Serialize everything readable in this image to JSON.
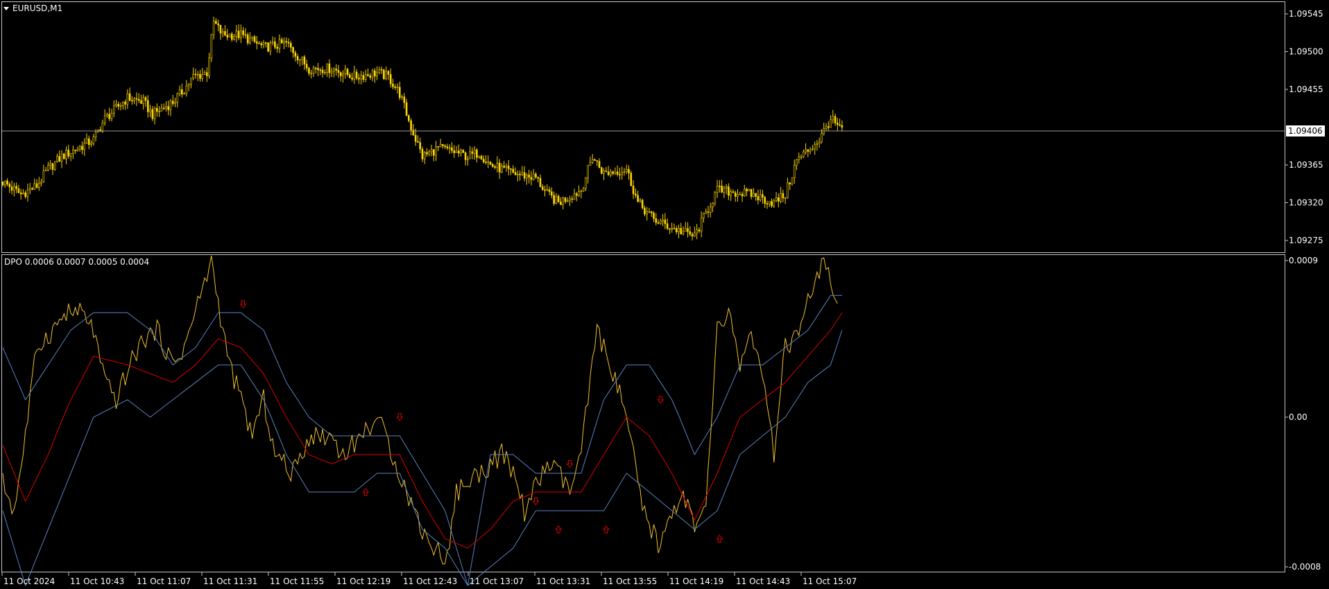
{
  "symbol_label": "EURUSD,M1",
  "indicator_label": "DPO 0.0006 0.0007 0.0005 0.0004",
  "colors": {
    "background": "#000000",
    "frame": "#c8c8c8",
    "candle": "#ffd700",
    "dpo": "#f2c12e",
    "band": "#5b84c4",
    "middle": "#e00000",
    "arrow": "#e00000",
    "price_line": "#9a9a9a"
  },
  "current_price": "1.09406",
  "chart_data": [
    {
      "type": "candlestick",
      "title": "EURUSD,M1",
      "ylim": [
        1.0926,
        1.0956
      ],
      "y_ticks": [
        "1.09545",
        "1.09500",
        "1.09455",
        "1.09365",
        "1.09320",
        "1.09275"
      ],
      "x_ticks": [
        "11 Oct 2024",
        "11 Oct 10:43",
        "11 Oct 11:07",
        "11 Oct 11:31",
        "11 Oct 11:55",
        "11 Oct 12:19",
        "11 Oct 12:43",
        "11 Oct 13:07",
        "11 Oct 13:31",
        "11 Oct 13:55",
        "11 Oct 14:19",
        "11 Oct 14:43",
        "11 Oct 15:07"
      ],
      "close_path": [
        [
          0,
          1.09345
        ],
        [
          8,
          1.0933
        ],
        [
          15,
          1.0934
        ],
        [
          20,
          1.0936
        ],
        [
          26,
          1.09375
        ],
        [
          33,
          1.09385
        ],
        [
          40,
          1.09395
        ],
        [
          45,
          1.0942
        ],
        [
          55,
          1.09445
        ],
        [
          62,
          1.0944
        ],
        [
          66,
          1.09425
        ],
        [
          75,
          1.0944
        ],
        [
          80,
          1.09455
        ],
        [
          84,
          1.0947
        ],
        [
          90,
          1.09475
        ],
        [
          93,
          1.09535
        ],
        [
          97,
          1.0952
        ],
        [
          105,
          1.0952
        ],
        [
          115,
          1.09505
        ],
        [
          125,
          1.0951
        ],
        [
          135,
          1.0948
        ],
        [
          145,
          1.0948
        ],
        [
          155,
          1.0947
        ],
        [
          165,
          1.09475
        ],
        [
          170,
          1.0947
        ],
        [
          175,
          1.0945
        ],
        [
          180,
          1.0941
        ],
        [
          185,
          1.09375
        ],
        [
          192,
          1.09385
        ],
        [
          200,
          1.0938
        ],
        [
          205,
          1.09375
        ],
        [
          210,
          1.0938
        ],
        [
          215,
          1.09365
        ],
        [
          225,
          1.09355
        ],
        [
          235,
          1.0935
        ],
        [
          240,
          1.0933
        ],
        [
          245,
          1.0932
        ],
        [
          255,
          1.09335
        ],
        [
          260,
          1.09375
        ],
        [
          265,
          1.09355
        ],
        [
          275,
          1.0936
        ],
        [
          280,
          1.0932
        ],
        [
          287,
          1.093
        ],
        [
          295,
          1.0929
        ],
        [
          305,
          1.0928
        ],
        [
          315,
          1.09335
        ],
        [
          330,
          1.0933
        ],
        [
          340,
          1.0932
        ],
        [
          345,
          1.0933
        ],
        [
          350,
          1.0937
        ],
        [
          360,
          1.09395
        ],
        [
          365,
          1.0942
        ],
        [
          370,
          1.09405
        ]
      ]
    },
    {
      "type": "line",
      "title": "DPO 0.0006 0.0007 0.0005 0.0004",
      "ylim": [
        -0.0008,
        0.0009
      ],
      "y_ticks": [
        "0.0009",
        "0.00",
        "-0.0008"
      ],
      "series": [
        {
          "name": "DPO",
          "points": [
            [
              0,
              -0.00035
            ],
            [
              5,
              -0.0005
            ],
            [
              10,
              -0.0001
            ],
            [
              15,
              0.0004
            ],
            [
              22,
              0.0005
            ],
            [
              28,
              0.0006
            ],
            [
              35,
              0.0006
            ],
            [
              40,
              0.0005
            ],
            [
              45,
              0.0002
            ],
            [
              50,
              0.0001
            ],
            [
              56,
              0.0003
            ],
            [
              62,
              0.00045
            ],
            [
              68,
              0.0005
            ],
            [
              75,
              0.0003
            ],
            [
              80,
              0.0004
            ],
            [
              86,
              0.00065
            ],
            [
              92,
              0.0009
            ],
            [
              97,
              0.0005
            ],
            [
              100,
              0.0003
            ],
            [
              105,
              0.0001
            ],
            [
              110,
              -0.0001
            ],
            [
              115,
              0.0001
            ],
            [
              120,
              -0.0002
            ],
            [
              128,
              -0.0003
            ],
            [
              135,
              -0.0001
            ],
            [
              145,
              -0.0001
            ],
            [
              150,
              -0.0002
            ],
            [
              158,
              -0.0001
            ],
            [
              165,
              0.0
            ],
            [
              172,
              -0.0002
            ],
            [
              178,
              -0.0004
            ],
            [
              185,
              -0.0006
            ],
            [
              190,
              -0.0007
            ],
            [
              196,
              -0.00075
            ],
            [
              200,
              -0.0004
            ],
            [
              210,
              -0.0003
            ],
            [
              220,
              -0.0002
            ],
            [
              225,
              -0.0003
            ],
            [
              230,
              -0.0005
            ],
            [
              240,
              -0.00025
            ],
            [
              245,
              -0.0003
            ],
            [
              250,
              -0.0004
            ],
            [
              255,
              -0.0002
            ],
            [
              262,
              0.0005
            ],
            [
              268,
              0.0003
            ],
            [
              275,
              0.0
            ],
            [
              282,
              -0.0005
            ],
            [
              290,
              -0.0007
            ],
            [
              295,
              -0.0005
            ],
            [
              300,
              -0.0004
            ],
            [
              305,
              -0.0006
            ],
            [
              310,
              -0.0005
            ],
            [
              315,
              0.0005
            ],
            [
              320,
              0.0006
            ],
            [
              325,
              0.0003
            ],
            [
              330,
              0.0005
            ],
            [
              335,
              0.0002
            ],
            [
              340,
              -0.0002
            ],
            [
              345,
              0.0004
            ],
            [
              352,
              0.0005
            ],
            [
              356,
              0.0007
            ],
            [
              362,
              0.0009
            ],
            [
              368,
              0.0006
            ]
          ]
        },
        {
          "name": "Upper band",
          "points": [
            [
              0,
              0.0004
            ],
            [
              10,
              0.0001
            ],
            [
              20,
              0.0003
            ],
            [
              30,
              0.0005
            ],
            [
              40,
              0.0006
            ],
            [
              55,
              0.0006
            ],
            [
              65,
              0.0005
            ],
            [
              75,
              0.0003
            ],
            [
              85,
              0.0004
            ],
            [
              95,
              0.0006
            ],
            [
              105,
              0.0006
            ],
            [
              115,
              0.0005
            ],
            [
              125,
              0.0002
            ],
            [
              135,
              0.0
            ],
            [
              145,
              -0.0001
            ],
            [
              155,
              -0.0001
            ],
            [
              165,
              -0.0001
            ],
            [
              175,
              -0.0001
            ],
            [
              185,
              -0.0003
            ],
            [
              195,
              -0.0005
            ],
            [
              205,
              -0.0009
            ],
            [
              215,
              -0.0002
            ],
            [
              225,
              -0.0002
            ],
            [
              235,
              -0.0003
            ],
            [
              245,
              -0.0003
            ],
            [
              255,
              -0.0003
            ],
            [
              265,
              0.0001
            ],
            [
              275,
              0.0003
            ],
            [
              285,
              0.0003
            ],
            [
              295,
              0.0001
            ],
            [
              305,
              -0.0002
            ],
            [
              315,
              0.0
            ],
            [
              325,
              0.0003
            ],
            [
              335,
              0.0003
            ],
            [
              345,
              0.0004
            ],
            [
              355,
              0.0005
            ],
            [
              365,
              0.0007
            ],
            [
              370,
              0.0007
            ]
          ]
        },
        {
          "name": "Lower band",
          "points": [
            [
              0,
              -0.0005
            ],
            [
              10,
              -0.0009
            ],
            [
              20,
              -0.0006
            ],
            [
              30,
              -0.0003
            ],
            [
              40,
              0.0
            ],
            [
              55,
              0.0001
            ],
            [
              65,
              0.0
            ],
            [
              75,
              0.0001
            ],
            [
              85,
              0.0002
            ],
            [
              95,
              0.0003
            ],
            [
              105,
              0.0003
            ],
            [
              115,
              0.0001
            ],
            [
              125,
              -0.0002
            ],
            [
              135,
              -0.0004
            ],
            [
              145,
              -0.0004
            ],
            [
              155,
              -0.0004
            ],
            [
              165,
              -0.0003
            ],
            [
              175,
              -0.0003
            ],
            [
              185,
              -0.0006
            ],
            [
              195,
              -0.0007
            ],
            [
              205,
              -0.0009
            ],
            [
              215,
              -0.0008
            ],
            [
              225,
              -0.0007
            ],
            [
              235,
              -0.0005
            ],
            [
              245,
              -0.0005
            ],
            [
              255,
              -0.0005
            ],
            [
              265,
              -0.0005
            ],
            [
              275,
              -0.0003
            ],
            [
              285,
              -0.0004
            ],
            [
              295,
              -0.0005
            ],
            [
              305,
              -0.0006
            ],
            [
              315,
              -0.0005
            ],
            [
              325,
              -0.0002
            ],
            [
              335,
              -0.0001
            ],
            [
              345,
              0.0
            ],
            [
              355,
              0.0002
            ],
            [
              365,
              0.0003
            ],
            [
              370,
              0.0005
            ]
          ]
        },
        {
          "name": "Middle",
          "points": [
            [
              0,
              -0.00015
            ],
            [
              10,
              -0.00045
            ],
            [
              20,
              -0.0002
            ],
            [
              30,
              0.0001
            ],
            [
              40,
              0.00035
            ],
            [
              55,
              0.0003
            ],
            [
              65,
              0.00025
            ],
            [
              75,
              0.0002
            ],
            [
              85,
              0.0003
            ],
            [
              95,
              0.00045
            ],
            [
              105,
              0.0004
            ],
            [
              115,
              0.00025
            ],
            [
              125,
              0.0
            ],
            [
              135,
              -0.0002
            ],
            [
              145,
              -0.00025
            ],
            [
              155,
              -0.0002
            ],
            [
              165,
              -0.0002
            ],
            [
              175,
              -0.0002
            ],
            [
              185,
              -0.00045
            ],
            [
              195,
              -0.00065
            ],
            [
              205,
              -0.0007
            ],
            [
              215,
              -0.0006
            ],
            [
              225,
              -0.00045
            ],
            [
              235,
              -0.0004
            ],
            [
              245,
              -0.0004
            ],
            [
              255,
              -0.0004
            ],
            [
              265,
              -0.0002
            ],
            [
              275,
              0.0
            ],
            [
              285,
              -0.0001
            ],
            [
              295,
              -0.0003
            ],
            [
              305,
              -0.00055
            ],
            [
              315,
              -0.0003
            ],
            [
              325,
              0.0
            ],
            [
              335,
              0.0001
            ],
            [
              345,
              0.0002
            ],
            [
              355,
              0.00035
            ],
            [
              365,
              0.0005
            ],
            [
              370,
              0.0006
            ]
          ]
        }
      ],
      "arrows_down": [
        [
          106,
          0.00065
        ],
        [
          175,
          0.0
        ],
        [
          235,
          -0.00045
        ],
        [
          250,
          -0.00025
        ],
        [
          290,
          0.0001
        ]
      ],
      "arrows_up": [
        [
          160,
          -0.0004
        ],
        [
          245,
          -0.0006
        ],
        [
          266,
          -0.0006
        ],
        [
          316,
          -0.00065
        ]
      ]
    }
  ]
}
